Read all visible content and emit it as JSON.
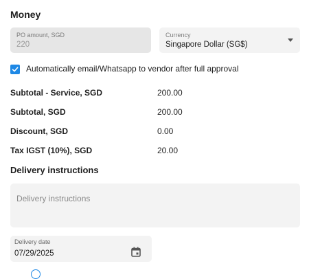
{
  "money": {
    "title": "Money",
    "po_amount": {
      "label": "PO amount, SGD",
      "value": "220"
    },
    "currency": {
      "label": "Currency",
      "value": "Singapore Dollar (SG$)"
    },
    "auto_email_label": "Automatically email/Whatsapp to vendor after full approval",
    "auto_email_checked": true
  },
  "totals": [
    {
      "label": "Subtotal - Service, SGD",
      "value": "200.00"
    },
    {
      "label": "Subtotal, SGD",
      "value": "200.00"
    },
    {
      "label": "Discount, SGD",
      "value": "0.00"
    },
    {
      "label": "Tax IGST (10%), SGD",
      "value": "20.00"
    }
  ],
  "delivery": {
    "title": "Delivery instructions",
    "instructions_placeholder": "Delivery instructions",
    "date_label": "Delivery date",
    "date_value": "07/29/2025"
  },
  "icons": {
    "dropdown": "chevron-down-icon",
    "checkbox": "check-icon",
    "calendar": "calendar-icon",
    "partial": "info-icon"
  },
  "colors": {
    "accent": "#1e88e5"
  }
}
